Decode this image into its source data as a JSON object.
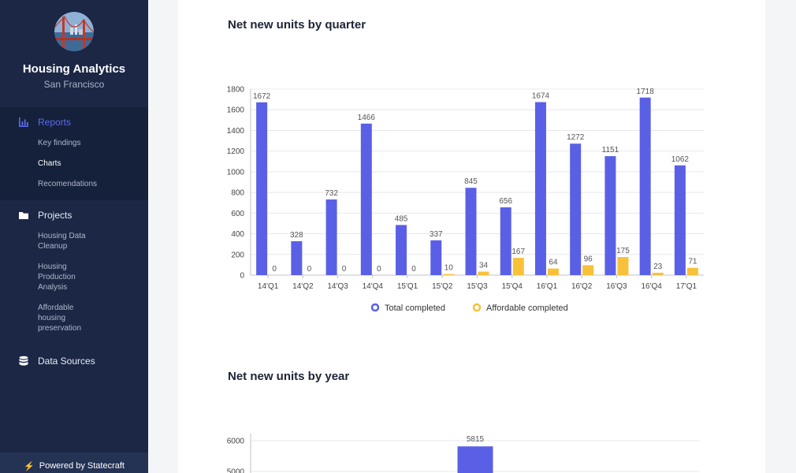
{
  "sidebar": {
    "title": "Housing Analytics",
    "subtitle": "San Francisco",
    "reports": {
      "label": "Reports",
      "items": [
        {
          "label": "Key findings"
        },
        {
          "label": "Charts"
        },
        {
          "label": "Recomendations"
        }
      ]
    },
    "projects": {
      "label": "Projects",
      "items": [
        {
          "label": "Housing Data Cleanup"
        },
        {
          "label": "Housing Production Analysis"
        },
        {
          "label": "Affordable housing preservation"
        }
      ]
    },
    "data_sources": {
      "label": "Data Sources"
    },
    "powered_by": "Powered by Statecraft"
  },
  "colors": {
    "sidebar_bg": "#1b2745",
    "accent": "#5a6cf0",
    "series_total": "#5a60e6",
    "series_affordable": "#f8c13a"
  },
  "icons": [
    "bar-chart-icon",
    "folder-icon",
    "database-icon",
    "bolt-icon",
    "avatar-golden-gate"
  ],
  "chart_data": [
    {
      "type": "bar",
      "title": "Net new units by quarter",
      "categories": [
        "14'Q1",
        "14'Q2",
        "14'Q3",
        "14'Q4",
        "15'Q1",
        "15'Q2",
        "15'Q3",
        "15'Q4",
        "16'Q1",
        "16'Q2",
        "16'Q3",
        "16'Q4",
        "17'Q1"
      ],
      "series": [
        {
          "name": "Total completed",
          "values": [
            1672,
            328,
            732,
            1466,
            485,
            337,
            845,
            656,
            1674,
            1272,
            1151,
            1718,
            1062
          ]
        },
        {
          "name": "Affordable completed",
          "values": [
            0,
            0,
            0,
            0,
            0,
            10,
            34,
            167,
            64,
            96,
            175,
            23,
            71
          ]
        }
      ],
      "ylim": [
        0,
        1800
      ],
      "yticks": [
        0,
        200,
        400,
        600,
        800,
        1000,
        1200,
        1400,
        1600,
        1800
      ],
      "grid": true,
      "legend": "bottom"
    },
    {
      "type": "bar",
      "title": "Net new units by year",
      "categories": [
        "",
        "",
        "",
        "",
        ""
      ],
      "series": [
        {
          "name": "Total completed",
          "values": [
            null,
            null,
            5815,
            null,
            null
          ]
        }
      ],
      "yticks": [
        5000,
        6000
      ],
      "grid": true
    }
  ]
}
